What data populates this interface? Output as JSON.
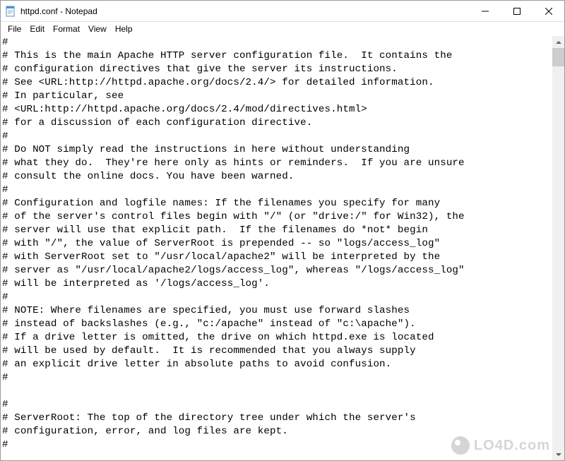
{
  "window": {
    "title": "httpd.conf - Notepad"
  },
  "menu": {
    "file": "File",
    "edit": "Edit",
    "format": "Format",
    "view": "View",
    "help": "Help"
  },
  "watermark": "LO4D.com",
  "content": "#\n# This is the main Apache HTTP server configuration file.  It contains the\n# configuration directives that give the server its instructions.\n# See <URL:http://httpd.apache.org/docs/2.4/> for detailed information.\n# In particular, see\n# <URL:http://httpd.apache.org/docs/2.4/mod/directives.html>\n# for a discussion of each configuration directive.\n#\n# Do NOT simply read the instructions in here without understanding\n# what they do.  They're here only as hints or reminders.  If you are unsure\n# consult the online docs. You have been warned.\n#\n# Configuration and logfile names: If the filenames you specify for many\n# of the server's control files begin with \"/\" (or \"drive:/\" for Win32), the\n# server will use that explicit path.  If the filenames do *not* begin\n# with \"/\", the value of ServerRoot is prepended -- so \"logs/access_log\"\n# with ServerRoot set to \"/usr/local/apache2\" will be interpreted by the\n# server as \"/usr/local/apache2/logs/access_log\", whereas \"/logs/access_log\"\n# will be interpreted as '/logs/access_log'.\n#\n# NOTE: Where filenames are specified, you must use forward slashes\n# instead of backslashes (e.g., \"c:/apache\" instead of \"c:\\apache\").\n# If a drive letter is omitted, the drive on which httpd.exe is located\n# will be used by default.  It is recommended that you always supply\n# an explicit drive letter in absolute paths to avoid confusion.\n#\n\n#\n# ServerRoot: The top of the directory tree under which the server's\n# configuration, error, and log files are kept.\n#"
}
